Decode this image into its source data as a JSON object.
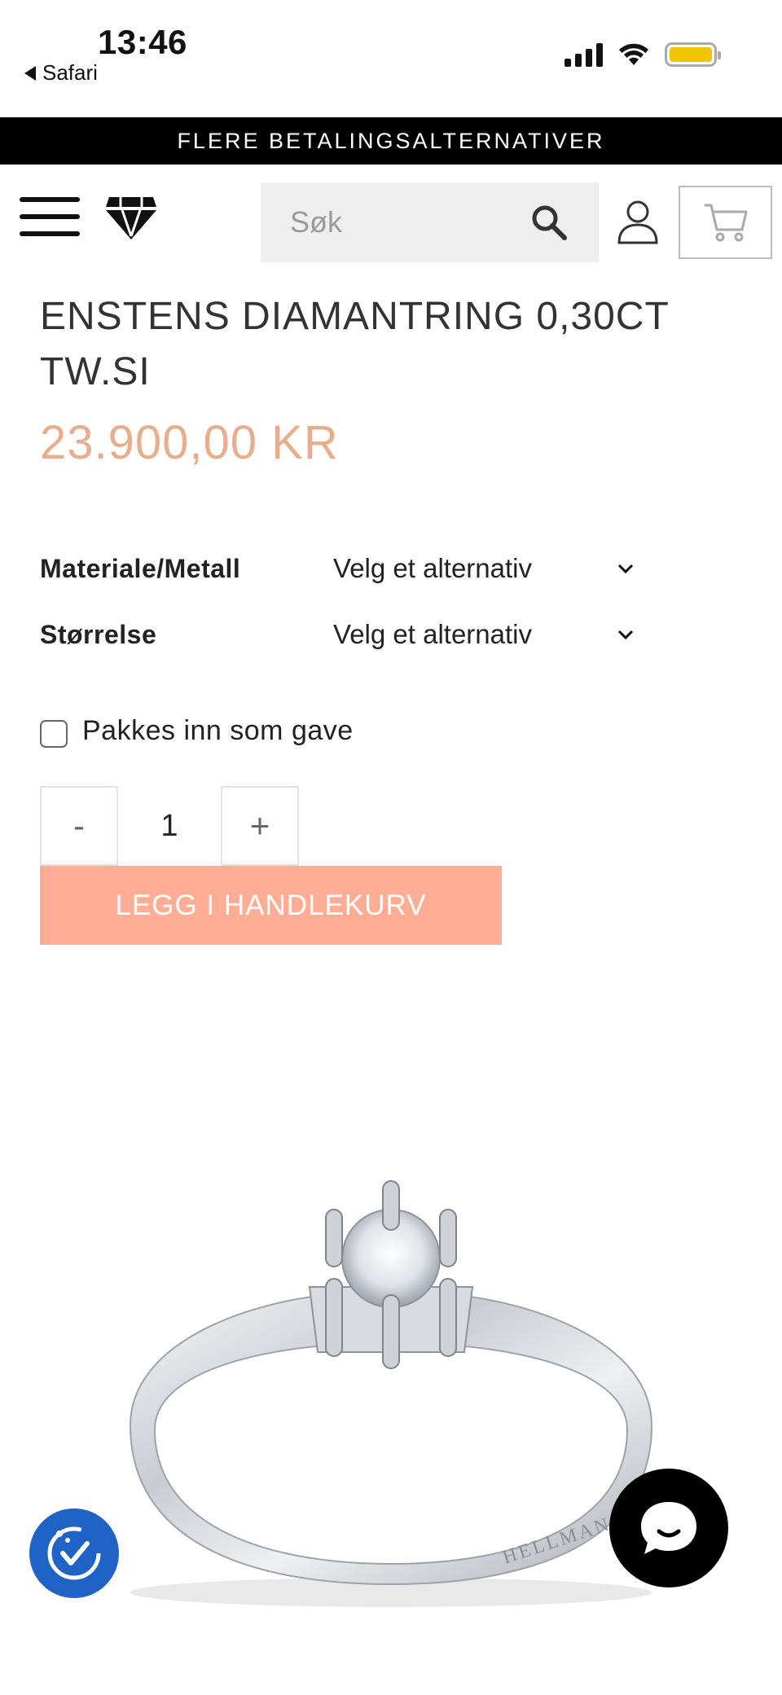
{
  "status_bar": {
    "time": "13:46",
    "back_label": "Safari"
  },
  "promo": {
    "text": "FLERE BETALINGSALTERNATIVER"
  },
  "header": {
    "search_placeholder": "Søk"
  },
  "product": {
    "title": "ENSTENS DIAMANTRING 0,30CT TW.SI",
    "price": "23.900,00 KR",
    "price_color": "#e8ae8c",
    "image_engraving": "HELLMAN"
  },
  "options": [
    {
      "label": "Materiale/Metall",
      "value": "Velg et alternativ"
    },
    {
      "label": "Størrelse",
      "value": "Velg et alternativ"
    }
  ],
  "gift": {
    "label": "Pakkes inn som gave",
    "checked": false
  },
  "quantity": {
    "minus": "-",
    "value": "1",
    "plus": "+"
  },
  "add_to_cart": {
    "label": "LEGG I HANDLEKURV",
    "color": "#ffad95"
  },
  "icons": {
    "menu": "hamburger-icon",
    "logo": "diamond-logo",
    "search": "search-icon",
    "account": "user-icon",
    "cart": "cart-icon",
    "accessibility": "accessibility-icon",
    "chat": "chat-icon"
  },
  "colors": {
    "accessibility_button": "#1f63c7",
    "chat_button": "#000000",
    "battery": "#f5c400"
  }
}
